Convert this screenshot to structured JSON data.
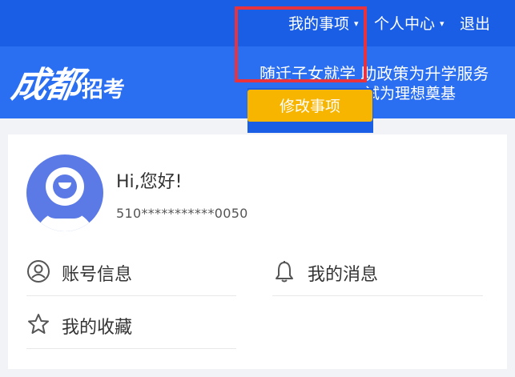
{
  "topbar": {
    "my_matters": "我的事项",
    "personal_center": "个人中心",
    "logout": "退出",
    "caret": "▾"
  },
  "header": {
    "logo_main": "成都",
    "logo_sub": "招考",
    "slogan_line1": "随迁子女就学  助政策为升学服务",
    "slogan_line2": "试为理想奠基"
  },
  "dropdown": {
    "modify_label": "修改事项"
  },
  "profile": {
    "greeting": "Hi,您好!",
    "id_number": "510***********0050"
  },
  "menu": {
    "account_info": "账号信息",
    "my_messages": "我的消息",
    "my_favorites": "我的收藏"
  },
  "colors": {
    "primary": "#1a5ee6",
    "header": "#2a6ef2",
    "button": "#f7b500",
    "highlight": "#e8333f",
    "avatar": "#5b7ae6"
  }
}
